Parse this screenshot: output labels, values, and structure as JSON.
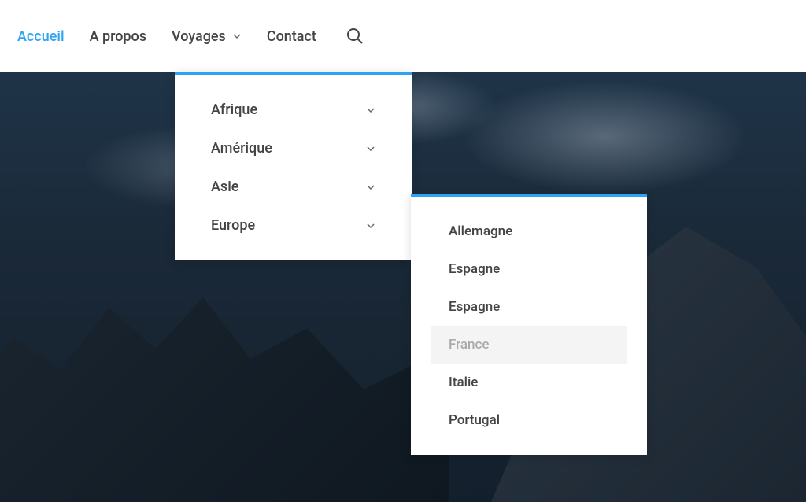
{
  "nav": {
    "items": [
      {
        "label": "Accueil",
        "active": true
      },
      {
        "label": "A propos",
        "active": false
      },
      {
        "label": "Voyages",
        "active": false,
        "has_dropdown": true
      },
      {
        "label": "Contact",
        "active": false
      }
    ]
  },
  "dropdown": {
    "items": [
      {
        "label": "Afrique"
      },
      {
        "label": "Amérique"
      },
      {
        "label": "Asie"
      },
      {
        "label": "Europe"
      }
    ]
  },
  "submenu": {
    "items": [
      {
        "label": "Allemagne"
      },
      {
        "label": "Espagne"
      },
      {
        "label": "Espagne"
      },
      {
        "label": "France",
        "hover": true
      },
      {
        "label": "Italie"
      },
      {
        "label": "Portugal"
      }
    ]
  },
  "colors": {
    "accent": "#2ea3f2",
    "text": "#444444"
  }
}
